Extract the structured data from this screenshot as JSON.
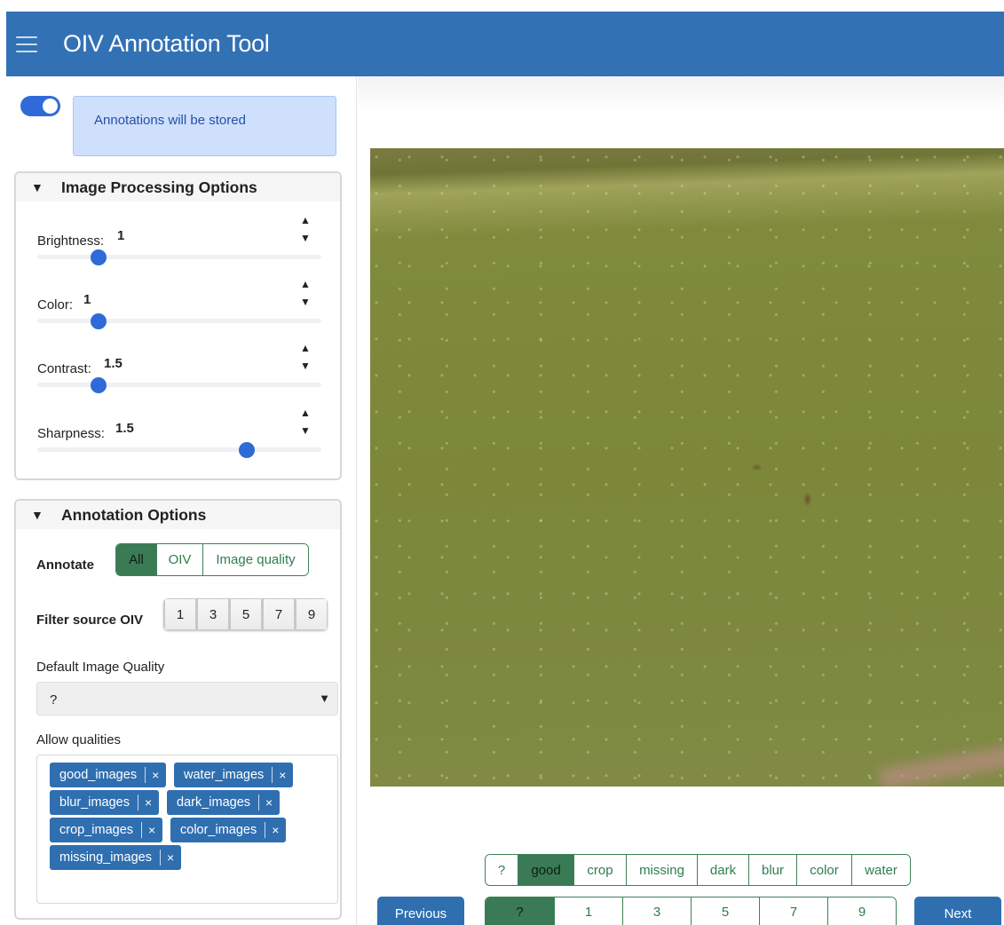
{
  "header": {
    "title": "OIV Annotation Tool",
    "menu_icon": "hamburger-menu-icon"
  },
  "store_toggle": {
    "on": true,
    "message": "Annotations will be stored"
  },
  "image_processing": {
    "title": "Image Processing Options",
    "collapse_icon": "triangle-down-icon",
    "sliders": [
      {
        "label": "Brightness:",
        "value": "1",
        "fraction": 0.2
      },
      {
        "label": "Color:",
        "value": "1",
        "fraction": 0.2
      },
      {
        "label": "Contrast:",
        "value": "1.5",
        "fraction": 0.2
      },
      {
        "label": "Sharpness:",
        "value": "1.5",
        "fraction": 0.75
      }
    ],
    "spin_up": "▲",
    "spin_down": "▼"
  },
  "annotation_options": {
    "title": "Annotation Options",
    "annotate_label": "Annotate",
    "annotate_options": [
      "All",
      "OIV",
      "Image quality"
    ],
    "annotate_selected": "All",
    "filter_label": "Filter source OIV",
    "filter_options": [
      "1",
      "3",
      "5",
      "7",
      "9"
    ],
    "default_quality_label": "Default Image Quality",
    "default_quality_value": "?",
    "select_caret": "▼",
    "allow_qualities_label": "Allow qualities",
    "allowed_qualities": [
      "good_images",
      "water_images",
      "blur_images",
      "dark_images",
      "crop_images",
      "color_images",
      "missing_images"
    ],
    "remove_symbol": "×"
  },
  "quality_selector": {
    "options": [
      "?",
      "good",
      "crop",
      "missing",
      "dark",
      "blur",
      "color",
      "water"
    ],
    "selected": "good"
  },
  "oiv_selector": {
    "options": [
      "?",
      "1",
      "3",
      "5",
      "7",
      "9"
    ],
    "selected": "?"
  },
  "navigation": {
    "previous": "Previous",
    "next": "Next"
  },
  "colors": {
    "header": "#3371b5",
    "accent_blue": "#2f6ad8",
    "tag_blue": "#2f6fb0",
    "selected_green": "#3a7a55"
  }
}
